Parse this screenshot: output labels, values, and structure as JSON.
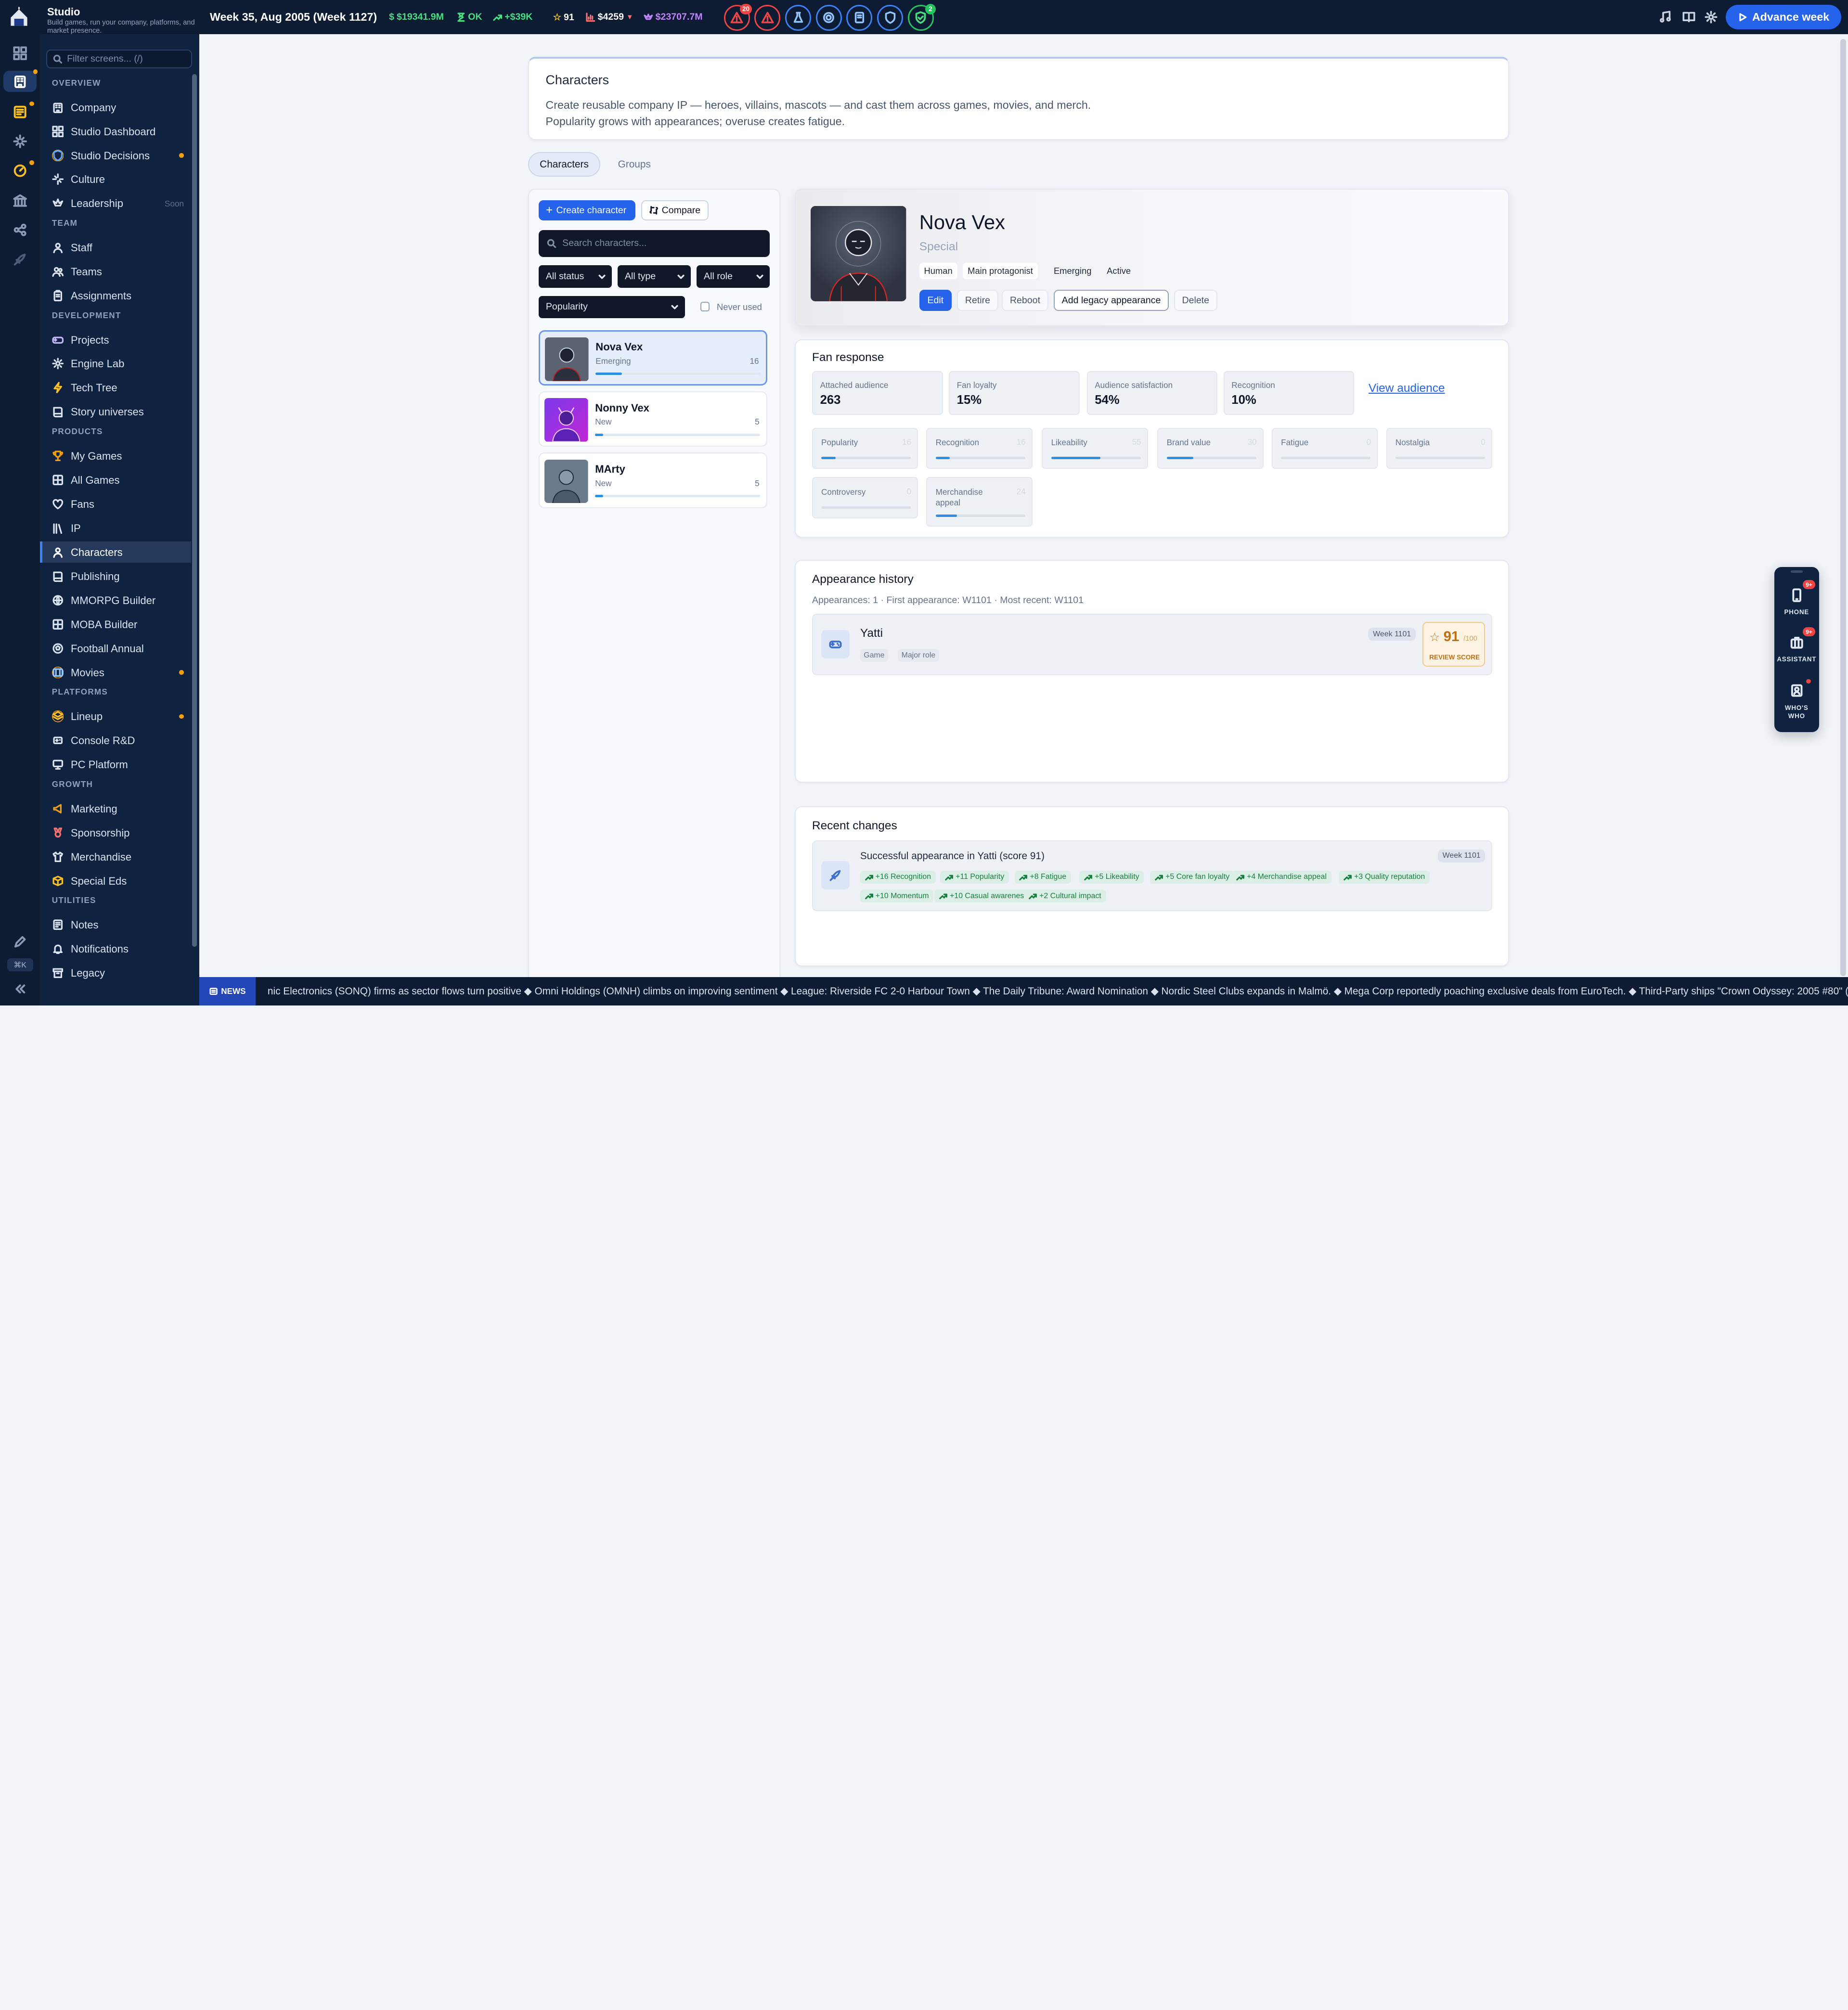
{
  "app": {
    "name": "Studio",
    "tagline": "Build games, run your company, platforms, and market presence."
  },
  "topbar": {
    "date": "Week 35, Aug 2005 (Week 1127)",
    "cash": "$19341.9M",
    "status": "OK",
    "delta": "+$39K",
    "reputation": "91",
    "share_price": "$4259",
    "valuation": "$23707.7M",
    "alerts": [
      {
        "name": "critical-alert-icon",
        "badge": "20",
        "color": "#ef4444"
      },
      {
        "name": "warning-alert-icon",
        "badge": "",
        "color": "#ef4444"
      },
      {
        "name": "staff-alert-icon",
        "badge": "",
        "color": "#3b82f6"
      },
      {
        "name": "studio-alert-icon",
        "badge": "",
        "color": "#3b82f6"
      },
      {
        "name": "console-alert-icon",
        "badge": "",
        "color": "#3b82f6"
      },
      {
        "name": "shield-alert-icon",
        "badge": "",
        "color": "#3b82f6"
      },
      {
        "name": "health-alert-icon",
        "badge": "2",
        "color": "#22c55e"
      }
    ],
    "advance_label": "Advance week"
  },
  "sidebar": {
    "filter_placeholder": "Filter screens... (/)",
    "sections": [
      {
        "title": "OVERVIEW",
        "items": [
          {
            "label": "Company",
            "icon": "building-icon"
          },
          {
            "label": "Studio Dashboard",
            "icon": "dashboard-icon"
          },
          {
            "label": "Studio Decisions",
            "icon": "shield-icon",
            "dot": true
          },
          {
            "label": "Culture",
            "icon": "sparkles-icon"
          },
          {
            "label": "Leadership",
            "icon": "crown-icon",
            "soon": "Soon"
          }
        ]
      },
      {
        "title": "TEAM",
        "items": [
          {
            "label": "Staff",
            "icon": "person-icon"
          },
          {
            "label": "Teams",
            "icon": "people-icon"
          },
          {
            "label": "Assignments",
            "icon": "clipboard-icon"
          }
        ]
      },
      {
        "title": "DEVELOPMENT",
        "items": [
          {
            "label": "Projects",
            "icon": "gamepad-icon"
          },
          {
            "label": "Engine Lab",
            "icon": "gear-icon"
          },
          {
            "label": "Tech Tree",
            "icon": "bolt-icon"
          },
          {
            "label": "Story universes",
            "icon": "book-icon"
          }
        ]
      },
      {
        "title": "PRODUCTS",
        "items": [
          {
            "label": "My Games",
            "icon": "trophy-icon"
          },
          {
            "label": "All Games",
            "icon": "grid-icon"
          },
          {
            "label": "Fans",
            "icon": "heart-icon"
          },
          {
            "label": "IP",
            "icon": "library-icon"
          },
          {
            "label": "Characters",
            "icon": "person-icon",
            "active": true
          },
          {
            "label": "Publishing",
            "icon": "book-icon"
          },
          {
            "label": "MMORPG Builder",
            "icon": "globe-icon"
          },
          {
            "label": "MOBA Builder",
            "icon": "grid-icon"
          },
          {
            "label": "Football Annual",
            "icon": "ball-icon"
          },
          {
            "label": "Movies",
            "icon": "film-icon",
            "dot": true
          }
        ]
      },
      {
        "title": "PLATFORMS",
        "items": [
          {
            "label": "Lineup",
            "icon": "layers-icon",
            "dot": true
          },
          {
            "label": "Console R&D",
            "icon": "console-icon"
          },
          {
            "label": "PC Platform",
            "icon": "monitor-icon"
          }
        ]
      },
      {
        "title": "GROWTH",
        "items": [
          {
            "label": "Marketing",
            "icon": "megaphone-icon"
          },
          {
            "label": "Sponsorship",
            "icon": "medal-icon"
          },
          {
            "label": "Merchandise",
            "icon": "shirt-icon"
          },
          {
            "label": "Special Eds",
            "icon": "box-icon"
          }
        ]
      },
      {
        "title": "UTILITIES",
        "items": [
          {
            "label": "Notes",
            "icon": "note-icon"
          },
          {
            "label": "Notifications",
            "icon": "bell-icon"
          },
          {
            "label": "Legacy",
            "icon": "archive-icon"
          }
        ]
      }
    ]
  },
  "rail": {
    "shortcut": "⌘K"
  },
  "page": {
    "title": "Characters",
    "desc1": "Create reusable company IP — heroes, villains, mascots — and cast them across games, movies, and merch.",
    "desc2": "Popularity grows with appearances; overuse creates fatigue.",
    "tabs": [
      "Characters",
      "Groups"
    ]
  },
  "list": {
    "create_label": "Create character",
    "compare_label": "Compare",
    "search_placeholder": "Search characters...",
    "filters": {
      "status": "All status",
      "type": "All type",
      "role": "All role",
      "sort": "Popularity",
      "never_used": "Never used"
    },
    "characters": [
      {
        "name": "Nova Vex",
        "status": "Emerging",
        "count": "16",
        "progress": 0.16,
        "selected": true
      },
      {
        "name": "Nonny Vex",
        "status": "New",
        "count": "5",
        "progress": 0.05
      },
      {
        "name": "MArty",
        "status": "New",
        "count": "5",
        "progress": 0.05
      }
    ]
  },
  "detail": {
    "name": "Nova Vex",
    "type": "Special",
    "tags": [
      "Human",
      "Main protagonist",
      "Emerging",
      "Active"
    ],
    "actions": {
      "edit": "Edit",
      "retire": "Retire",
      "reboot": "Reboot",
      "legacy": "Add legacy appearance",
      "delete": "Delete"
    }
  },
  "fan": {
    "title": "Fan response",
    "kpis": [
      {
        "label": "Attached audience",
        "value": "263"
      },
      {
        "label": "Fan loyalty",
        "value": "15%"
      },
      {
        "label": "Audience satisfaction",
        "value": "54%"
      },
      {
        "label": "Recognition",
        "value": "10%"
      }
    ],
    "view_audience": "View audience",
    "metrics": [
      {
        "label": "Popularity",
        "value": "16",
        "progress": 0.16
      },
      {
        "label": "Recognition",
        "value": "16",
        "progress": 0.16
      },
      {
        "label": "Likeability",
        "value": "55",
        "progress": 0.55
      },
      {
        "label": "Brand value",
        "value": "30",
        "progress": 0.3
      },
      {
        "label": "Fatigue",
        "value": "0",
        "progress": 0
      },
      {
        "label": "Nostalgia",
        "value": "0",
        "progress": 0
      },
      {
        "label": "Controversy",
        "value": "0",
        "progress": 0
      },
      {
        "label": "Merchandise appeal",
        "value": "24",
        "progress": 0.24
      }
    ]
  },
  "appearances": {
    "title": "Appearance history",
    "summary": "Appearances: 1 · First appearance: W1101 · Most recent: W1101",
    "items": [
      {
        "title": "Yatti",
        "kind": "Game",
        "role": "Major role",
        "week": "Week 1101",
        "score": "91",
        "score_max": "/100",
        "score_label": "REVIEW SCORE"
      }
    ]
  },
  "recent": {
    "title": "Recent changes",
    "items": [
      {
        "text": "Successful appearance in Yatti (score 91)",
        "week": "Week 1101",
        "deltas": [
          "+16 Recognition",
          "+11 Popularity",
          "+8 Fatigue",
          "+5 Likeability",
          "+5 Core fan loyalty",
          "+4 Merchandise appeal",
          "+3 Quality reputation",
          "+10 Momentum",
          "+10 Casual awareness",
          "+2 Cultural impact"
        ]
      }
    ]
  },
  "dock": {
    "phone": "PHONE",
    "phone_badge": "9+",
    "assistant": "ASSISTANT",
    "assistant_badge": "9+",
    "whos1": "WHO'S",
    "whos2": "WHO"
  },
  "ticker": {
    "label": "NEWS",
    "text": "nic Electronics (SONQ) firms as sector flows turn positive ◆ Omni Holdings (OMNH) climbs on improving sentiment ◆ League: Riverside FC 2-0 Harbour Town ◆ The Daily Tribune: Award Nomination ◆ Nordic Steel Clubs expands in Malmö. ◆ Mega Corp reportedly poaching exclusive deals from EuroTech. ◆ Third-Party ships \"Crown Odyssey: 2005 #80\" (56/100). ◆ A decision wh"
  },
  "colors": {
    "accent": "#2563eb",
    "nav_bg": "#0f2240",
    "topbar_bg": "#0d1b33",
    "progress": "#2d8ee6",
    "positive": "#15803d",
    "score": "#c2700f"
  }
}
